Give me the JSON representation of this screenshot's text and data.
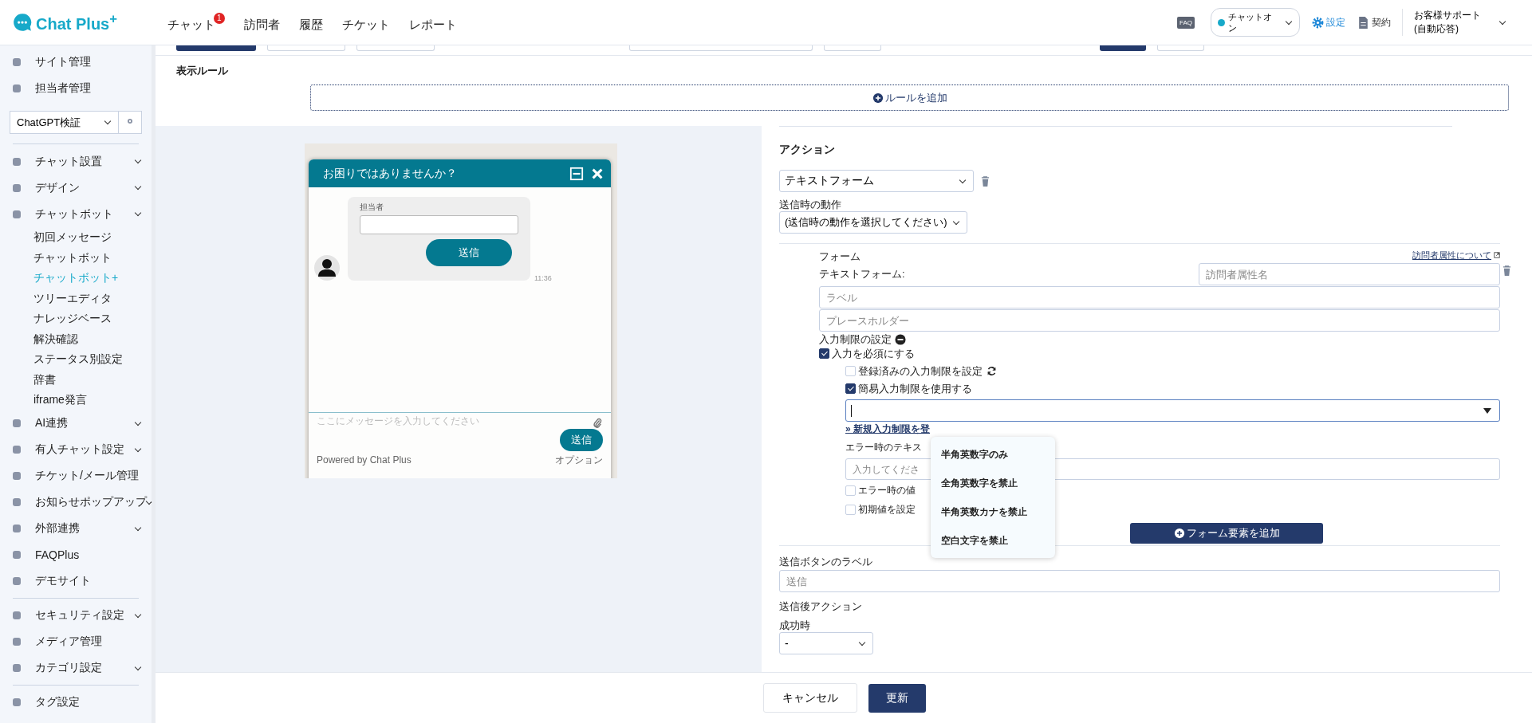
{
  "header": {
    "logo": "Chat Plus$^{+}$",
    "nav": [
      {
        "label": "チャット",
        "badge": "1"
      },
      {
        "label": "訪問者"
      },
      {
        "label": "履歴"
      },
      {
        "label": "チケット"
      },
      {
        "label": "レポート"
      }
    ],
    "faq": "FAQ",
    "status": "チャットオン",
    "settings": {
      "label": "設定",
      "selected": true
    },
    "contract": {
      "label": "契約",
      "selected": false
    },
    "user": "お客様サポート(自動応答)"
  },
  "sidebar": {
    "top_items": [
      "サイト管理",
      "担当者管理"
    ],
    "site_select": "ChatGPT検証",
    "sections": [
      [
        {
          "label": "チャット設置",
          "expandable": true
        },
        {
          "label": "デザイン",
          "expandable": true
        },
        {
          "label": "チャットボット",
          "expandable": true,
          "children": [
            {
              "label": "初回メッセージ",
              "selected": false
            },
            {
              "label": "チャットボット",
              "selected": false
            },
            {
              "label": "チャットボット+",
              "selected": true
            },
            {
              "label": "ツリーエディタ",
              "selected": false
            },
            {
              "label": "ナレッジベース",
              "selected": false
            },
            {
              "label": "解決確認",
              "selected": false
            },
            {
              "label": "ステータス別設定",
              "selected": false
            },
            {
              "label": "辞書",
              "selected": false
            },
            {
              "label": "iframe発言",
              "selected": false
            }
          ]
        },
        {
          "label": "AI連携",
          "expandable": true
        },
        {
          "label": "有人チャット設定",
          "expandable": true
        },
        {
          "label": "チケット/メール管理",
          "expandable": false
        },
        {
          "label": "お知らせポップアップ",
          "expandable": true
        },
        {
          "label": "外部連携",
          "expandable": true
        },
        {
          "label": "FAQPlus",
          "expandable": false
        },
        {
          "label": "デモサイト",
          "expandable": false
        }
      ],
      [
        {
          "label": "セキュリティ設定",
          "expandable": true
        },
        {
          "label": "メディア管理",
          "expandable": false
        },
        {
          "label": "カテゴリ設定",
          "expandable": true
        }
      ],
      [
        {
          "label": "タグ設定",
          "expandable": false
        }
      ]
    ]
  },
  "rules": {
    "title": "表示ルール",
    "add_button": "ルールを追加"
  },
  "preview": {
    "title": "お困りではありませんか？",
    "field_label": "担当者",
    "send_button": "送信",
    "time": "11:36",
    "composer_placeholder": "ここにメッセージを入力してください",
    "composer_send": "送信",
    "powered_by": "Powered by Chat Plus",
    "options": "オプション"
  },
  "action": {
    "title": "アクション",
    "type_select": "テキストフォーム",
    "on_send_label": "送信時の動作",
    "on_send_select": "(送信時の動作を選択してください)",
    "form": {
      "title": "フォーム",
      "attr_link": "訪問者属性について",
      "text_form_label": "テキストフォーム:",
      "attr_placeholder": "訪問者属性名",
      "label_placeholder": "ラベル",
      "placeholder_placeholder": "プレースホルダー",
      "restriction_label": "入力制限の設定",
      "required": {
        "label": "入力を必須にする",
        "checked": true
      },
      "registered": {
        "label": "登録済みの入力制限を設定",
        "checked": false
      },
      "simple": {
        "label": "簡易入力制限を使用する",
        "checked": true
      },
      "new_link": "» 新規入力制限を登",
      "error_text_label": "エラー時のテキス",
      "error_placeholder": "入力してくださ",
      "error_value": {
        "label": "エラー時の値",
        "checked": false
      },
      "initial_value": {
        "label": "初期値を設定",
        "checked": false
      },
      "add_element": "フォーム要素を追加"
    },
    "send_label_title": "送信ボタンのラベル",
    "send_label_placeholder": "送信",
    "after_title": "送信後アクション",
    "success_label": "成功時",
    "success_select": "-"
  },
  "popup": [
    {
      "label": "半角英数字のみ",
      "selected": false
    },
    {
      "label": "全角英数字を禁止",
      "selected": false
    },
    {
      "label": "半角英数カナを禁止",
      "selected": false
    },
    {
      "label": "空白文字を禁止",
      "selected": false
    }
  ],
  "footer": {
    "cancel": "キャンセル",
    "update": "更新"
  }
}
